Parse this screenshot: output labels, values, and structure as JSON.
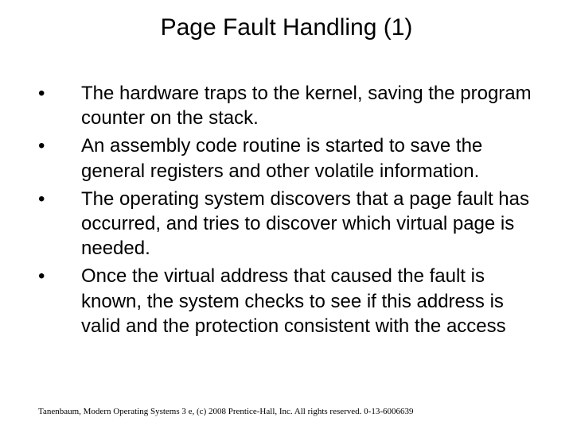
{
  "title": "Page Fault Handling (1)",
  "bullets": [
    "The hardware traps to the kernel, saving the program counter on the stack.",
    "An assembly code routine is started to save the general registers and other volatile information.",
    "The operating system discovers that a page fault has occurred, and tries to discover which virtual page is needed.",
    "Once the virtual address that caused the fault is known, the system checks to see if this address is valid and the protection consistent with the access"
  ],
  "footer": "Tanenbaum, Modern Operating Systems 3 e, (c) 2008 Prentice-Hall, Inc. All rights reserved. 0-13-6006639"
}
